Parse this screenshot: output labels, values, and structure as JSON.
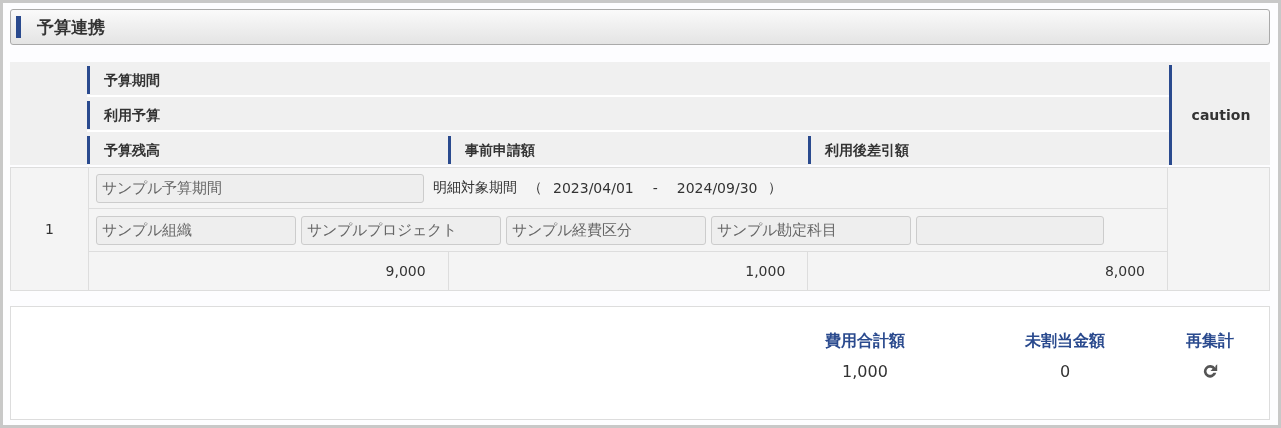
{
  "panel": {
    "title": "予算連携"
  },
  "table": {
    "header": {
      "row_1": "予算期間",
      "row_2": "利用予算",
      "row_3": [
        "予算残高",
        "事前申請額",
        "利用後差引額"
      ],
      "caution": "caution"
    },
    "rows": [
      {
        "number": "1",
        "period_field": "サンプル予算期間",
        "period_label": "明細対象期間",
        "period_open": "（",
        "period_start": "2023/04/01",
        "period_sep": "-",
        "period_end": "2024/09/30",
        "period_close": "）",
        "fields": [
          "サンプル組織",
          "サンプルプロジェクト",
          "サンプル経費区分",
          "サンプル勘定科目"
        ],
        "amounts": [
          "9,000",
          "1,000",
          "8,000"
        ]
      }
    ]
  },
  "summary": {
    "columns": [
      {
        "kind": "value",
        "label": "費用合計額",
        "value": "1,000"
      },
      {
        "kind": "value",
        "label": "未割当金額",
        "value": "0"
      },
      {
        "kind": "action",
        "label": "再集計"
      }
    ]
  }
}
